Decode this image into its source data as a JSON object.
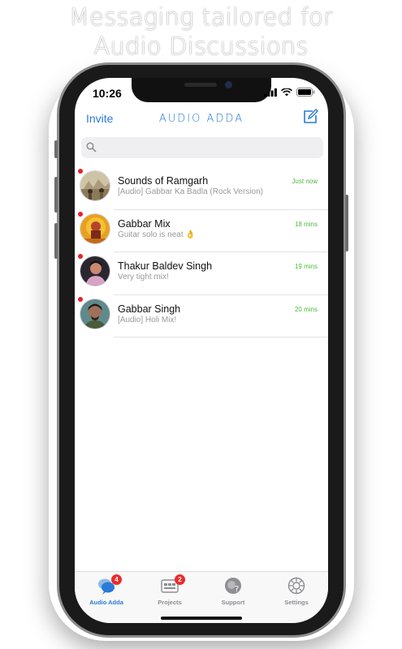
{
  "headline": {
    "line1": "Messaging tailored for",
    "line2": "Audio Discussions"
  },
  "status_bar": {
    "time": "10:26",
    "icons": [
      "signal-icon",
      "wifi-icon",
      "battery-icon"
    ]
  },
  "navbar": {
    "invite_label": "Invite",
    "title": "AUDIO ADDA",
    "compose_icon": "compose-icon"
  },
  "search": {
    "placeholder": "",
    "value": "",
    "icon": "search-icon"
  },
  "conversations": [
    {
      "name": "Sounds of Ramgarh",
      "preview": "[Audio] Gabbar Ka Badla (Rock Version)",
      "time": "Just now",
      "unread": true
    },
    {
      "name": "Gabbar Mix",
      "preview": "Guitar solo is neat 👌",
      "time": "18 mins",
      "unread": true
    },
    {
      "name": "Thakur Baldev Singh",
      "preview": "Very tight mix!",
      "time": "19 mins",
      "unread": true
    },
    {
      "name": "Gabbar Singh",
      "preview": "[Audio] Holi Mix!",
      "time": "20 mins",
      "unread": true
    }
  ],
  "tabs": [
    {
      "label": "Audio Adda",
      "badge": "4",
      "icon": "chat-bubbles-icon",
      "active": true
    },
    {
      "label": "Projects",
      "badge": "2",
      "icon": "projects-icon",
      "active": false
    },
    {
      "label": "Support",
      "badge": "",
      "icon": "support-icon",
      "active": false
    },
    {
      "label": "Settings",
      "badge": "",
      "icon": "settings-gear-icon",
      "active": false
    }
  ],
  "colors": {
    "accent": "#2a7bd5",
    "unread_dot": "#e8202a",
    "time_green": "#4cbb3a",
    "badge_red": "#ec2b2b"
  }
}
